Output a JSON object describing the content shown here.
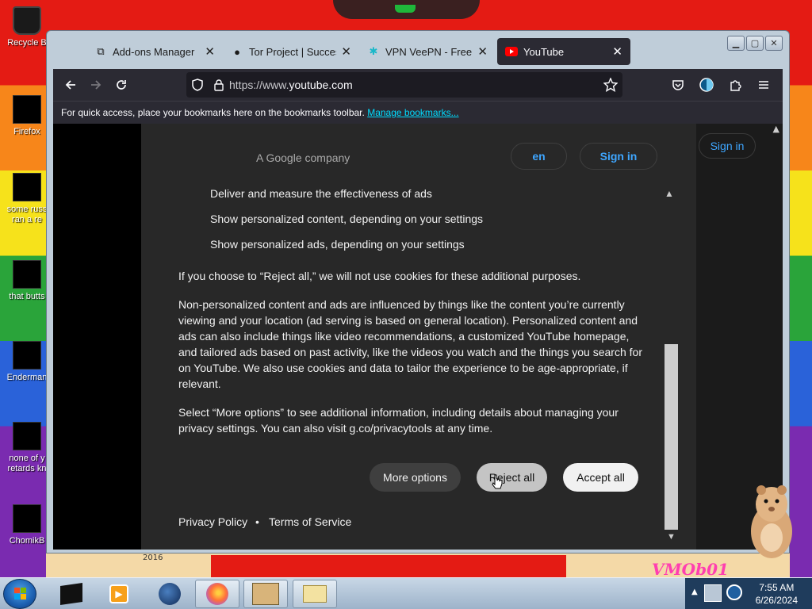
{
  "desktop": {
    "icons": [
      {
        "label": "Recycle B",
        "name": "recycle-bin"
      },
      {
        "label": "Firefox",
        "name": "firefox"
      },
      {
        "label": "some russ ran a re",
        "name": "some-russ"
      },
      {
        "label": "that butts",
        "name": "that-butts"
      },
      {
        "label": "Enderman",
        "name": "enderman"
      },
      {
        "label": "none of y retards kn",
        "name": "none-of-y"
      },
      {
        "label": "ChomikB",
        "name": "chomikb"
      }
    ],
    "wallpaper_text": "VMOb01",
    "year_text": "2016"
  },
  "browser": {
    "tabs": [
      {
        "label": "Add-ons Manager",
        "icon": "puzzle-icon",
        "active": false
      },
      {
        "label": "Tor Project | Success",
        "icon": "onion-icon",
        "active": false
      },
      {
        "label": "VPN VeePN - Free VPN",
        "icon": "veepn-icon",
        "active": false
      },
      {
        "label": "YouTube",
        "icon": "youtube-icon",
        "active": true
      }
    ],
    "url_prefix": "https://www.",
    "url_domain": "youtube.com",
    "bookmarks_text": "For quick access, place your bookmarks here on the bookmarks toolbar.",
    "bookmarks_link": "Manage bookmarks..."
  },
  "youtube": {
    "sign_in": "Sign in"
  },
  "consent": {
    "company": "A Google company",
    "lang_button": "en",
    "sign_in": "Sign in",
    "list_items": [
      "Deliver and measure the effectiveness of ads",
      "Show personalized content, depending on your settings",
      "Show personalized ads, depending on your settings"
    ],
    "paragraphs": [
      "If you choose to “Reject all,” we will not use cookies for these additional purposes.",
      "Non-personalized content and ads are influenced by things like the content you’re currently viewing and your location (ad serving is based on general location). Personalized content and ads can also include things like video recommendations, a customized YouTube homepage, and tailored ads based on past activity, like the videos you watch and the things you search for on YouTube. We also use cookies and data to tailor the experience to be age-appropriate, if relevant.",
      "Select “More options” to see additional information, including details about managing your privacy settings. You can also visit g.co/privacytools at any time."
    ],
    "buttons": {
      "more": "More options",
      "reject": "Reject all",
      "accept": "Accept all"
    },
    "footer": {
      "privacy": "Privacy Policy",
      "separator": "•",
      "terms": "Terms of Service"
    }
  },
  "taskbar": {
    "time": "7:55 AM",
    "date": "6/26/2024"
  }
}
